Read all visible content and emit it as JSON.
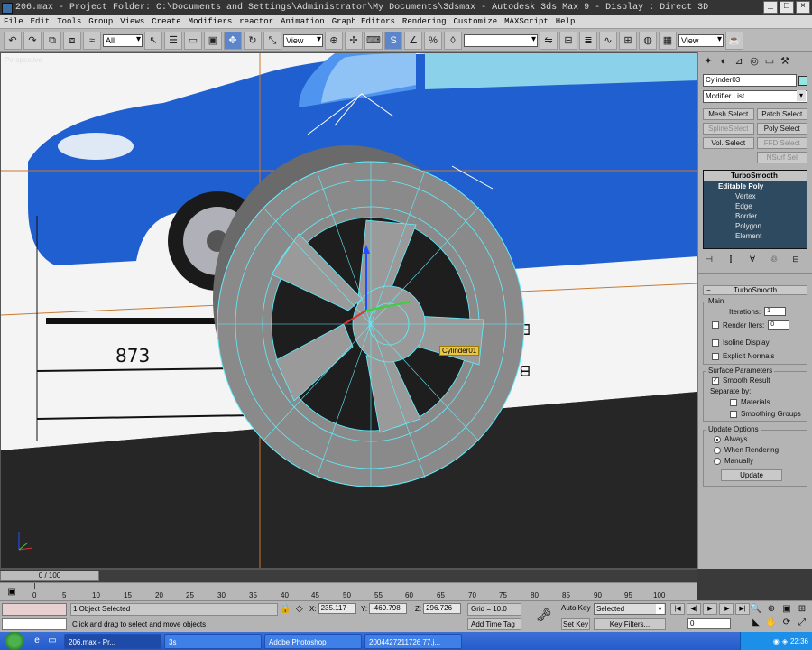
{
  "window": {
    "title": "206.max    - Project Folder: C:\\Documents and Settings\\Administrator\\My Documents\\3dsmax    - Autodesk 3ds Max 9    - Display : Direct 3D",
    "controls": [
      "_",
      "□",
      "×"
    ]
  },
  "menu": [
    "File",
    "Edit",
    "Tools",
    "Group",
    "Views",
    "Create",
    "Modifiers",
    "reactor",
    "Animation",
    "Graph Editors",
    "Rendering",
    "Customize",
    "MAXScript",
    "Help"
  ],
  "toolbar": {
    "selection_filter": "All",
    "ref_coord": "View",
    "named_selection": "",
    "view_right": "View",
    "icons": [
      "undo-icon",
      "redo-icon",
      "link-icon",
      "unlink-icon",
      "bind-spacewarp-icon",
      "select-icon",
      "select-by-name-icon",
      "rect-region-icon",
      "window-crossing-icon",
      "move-icon",
      "rotate-icon",
      "scale-icon",
      "pivot-icon",
      "select-manipulate-icon",
      "keyboard-shortcut-icon",
      "snap-icon",
      "angle-snap-icon",
      "percent-snap-icon",
      "spinner-snap-icon",
      "edit-named-sel-icon",
      "mirror-icon",
      "align-icon",
      "layer-icon",
      "curve-editor-icon",
      "schematic-icon",
      "material-editor-icon",
      "render-setup-icon",
      "render-icon"
    ]
  },
  "viewport": {
    "label": "Perspective",
    "object_tag": "Cylinder01"
  },
  "command_panel": {
    "object_name": "Cylinder03",
    "object_color": "#93e6e2",
    "modifier_list": "Modifier List",
    "buttons": [
      {
        "label": "Mesh Select",
        "enabled": true
      },
      {
        "label": "Patch Select",
        "enabled": true
      },
      {
        "label": "SplineSelect",
        "enabled": false
      },
      {
        "label": "Poly Select",
        "enabled": true
      },
      {
        "label": "Vol. Select",
        "enabled": true
      },
      {
        "label": "FFD Select",
        "enabled": false
      },
      {
        "label": "",
        "enabled": false
      },
      {
        "label": "NSurf Sel",
        "enabled": false
      }
    ],
    "stack": {
      "top": "TurboSmooth",
      "base": "Editable Poly",
      "subobjects": [
        "Vertex",
        "Edge",
        "Border",
        "Polygon",
        "Element"
      ]
    },
    "rollout_title": "TurboSmooth",
    "main_group": "Main",
    "iterations_label": "Iterations:",
    "iterations_value": "1",
    "render_iters_label": "Render Iters:",
    "render_iters_value": "0",
    "isoline_display": "Isoline Display",
    "explicit_normals": "Explicit Normals",
    "surface_params": "Surface Parameters",
    "smooth_result": "Smooth Result",
    "separate_by": "Separate by:",
    "materials": "Materials",
    "smoothing_groups": "Smoothing Groups",
    "update_options": "Update Options",
    "always": "Always",
    "when_rendering": "When Rendering",
    "manually": "Manually",
    "update_button": "Update"
  },
  "timeline": {
    "slider": "0 / 100",
    "ticks": [
      "0",
      "5",
      "10",
      "15",
      "20",
      "25",
      "30",
      "35",
      "40",
      "45",
      "50",
      "55",
      "60",
      "65",
      "70",
      "75",
      "80",
      "85",
      "90",
      "95",
      "100"
    ]
  },
  "status": {
    "objects_selected": "1 Object Selected",
    "prompt": "Click and drag to select and move objects",
    "x_label": "X:",
    "x_value": "235.117",
    "y_label": "Y:",
    "y_value": "-469.798",
    "z_label": "Z:",
    "z_value": "296.726",
    "grid": "Grid = 10.0",
    "add_time_tag": "Add Time Tag",
    "auto_key": "Auto Key",
    "set_key": "Set Key",
    "selected": "Selected",
    "key_filters": "Key Filters...",
    "frame": "0"
  },
  "taskbar": {
    "tasks": [
      "206.max   - Pr...",
      "3s",
      "Adobe Photoshop",
      "2004427211726 77.j..."
    ],
    "clock": "22:36"
  }
}
